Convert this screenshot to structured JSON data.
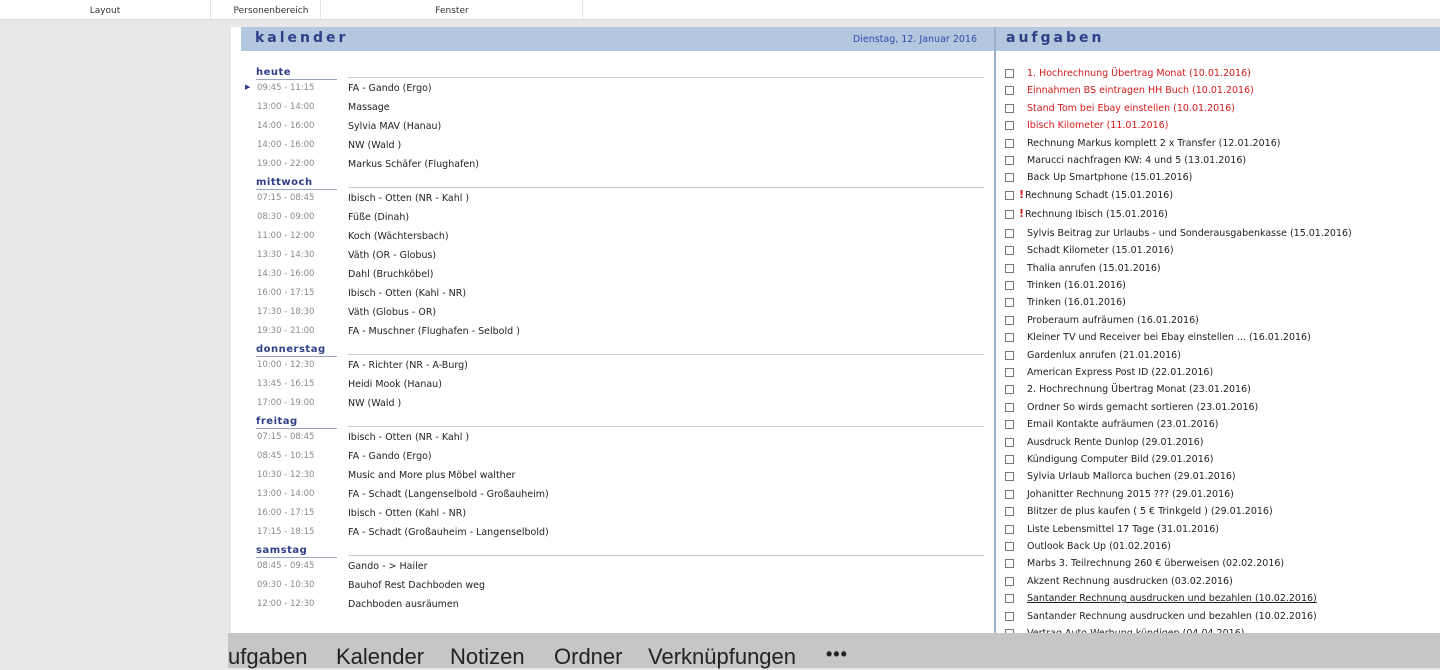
{
  "topbar": {
    "tabs": [
      "Layout",
      "Personenbereich",
      "Fenster"
    ]
  },
  "calendar": {
    "title": "kalender",
    "date": "Dienstag, 12. Januar 2016",
    "days": [
      {
        "name": "heute",
        "appointments": [
          {
            "time": "09:45 - 11:15",
            "title": "FA - Gando (Ergo)",
            "current": true
          },
          {
            "time": "13:00 - 14:00",
            "title": "Massage"
          },
          {
            "time": "14:00 - 16:00",
            "title": "Sylvia MAV (Hanau)"
          },
          {
            "time": "14:00 - 16:00",
            "title": "NW (Wald )"
          },
          {
            "time": "19:00 - 22:00",
            "title": "Markus Schäfer (Flughafen)"
          }
        ]
      },
      {
        "name": "mittwoch",
        "appointments": [
          {
            "time": "07:15 - 08:45",
            "title": "Ibisch - Otten (NR - Kahl )"
          },
          {
            "time": "08:30 - 09:00",
            "title": "Füße (Dinah)"
          },
          {
            "time": "11:00 - 12:00",
            "title": "Koch (Wächtersbach)"
          },
          {
            "time": "13:30 - 14:30",
            "title": "Väth (OR - Globus)"
          },
          {
            "time": "14:30 - 16:00",
            "title": "Dahl (Bruchköbel)"
          },
          {
            "time": "16:00 - 17:15",
            "title": "Ibisch - Otten (Kahl - NR)"
          },
          {
            "time": "17:30 - 18:30",
            "title": "Väth (Globus - OR)"
          },
          {
            "time": "19:30 - 21:00",
            "title": "FA - Muschner (Flughafen - Selbold )"
          }
        ]
      },
      {
        "name": "donnerstag",
        "appointments": [
          {
            "time": "10:00 - 12:30",
            "title": "FA - Richter (NR - A-Burg)"
          },
          {
            "time": "13:45 - 16:15",
            "title": "Heidi Mook (Hanau)"
          },
          {
            "time": "17:00 - 19:00",
            "title": "NW (Wald )"
          }
        ]
      },
      {
        "name": "freitag",
        "appointments": [
          {
            "time": "07:15 - 08:45",
            "title": "Ibisch - Otten (NR - Kahl )"
          },
          {
            "time": "08:45 - 10:15",
            "title": "FA - Gando (Ergo)"
          },
          {
            "time": "10:30 - 12:30",
            "title": "Music and More plus Möbel walther"
          },
          {
            "time": "13:00 - 14:00",
            "title": "FA - Schadt (Langenselbold - Großauheim)"
          },
          {
            "time": "16:00 - 17:15",
            "title": "Ibisch - Otten (Kahl - NR)"
          },
          {
            "time": "17:15 - 18:15",
            "title": "FA - Schadt (Großauheim - Langenselbold)"
          }
        ]
      },
      {
        "name": "samstag",
        "appointments": [
          {
            "time": "08:45 - 09:45",
            "title": "Gando - > Hailer"
          },
          {
            "time": "09:30 - 10:30",
            "title": "Bauhof Rest Dachboden weg"
          },
          {
            "time": "12:00 - 12:30",
            "title": "Dachboden ausräumen"
          }
        ]
      }
    ]
  },
  "tasks": {
    "title": "aufgaben",
    "items": [
      {
        "text": "1. Hochrechnung Übertrag Monat (10.01.2016)",
        "overdue": true
      },
      {
        "text": "Einnahmen BS eintragen HH Buch (10.01.2016)",
        "overdue": true
      },
      {
        "text": "Stand Tom bei Ebay einstellen (10.01.2016)",
        "overdue": true
      },
      {
        "text": "Ibisch Kilometer (11.01.2016)",
        "overdue": true
      },
      {
        "text": "Rechnung Markus komplett 2 x Transfer (12.01.2016)"
      },
      {
        "text": "Marucci nachfragen KW: 4 und 5 (13.01.2016)"
      },
      {
        "text": "Back Up Smartphone (15.01.2016)"
      },
      {
        "text": "Rechnung Schadt (15.01.2016)",
        "important": true
      },
      {
        "text": "Rechnung Ibisch (15.01.2016)",
        "important": true
      },
      {
        "text": "Sylvis Beitrag zur Urlaubs - und Sonderausgabenkasse (15.01.2016)"
      },
      {
        "text": "Schadt Kilometer (15.01.2016)"
      },
      {
        "text": "Thalia anrufen (15.01.2016)"
      },
      {
        "text": "Trinken (16.01.2016)"
      },
      {
        "text": "Trinken (16.01.2016)"
      },
      {
        "text": "Proberaum aufräumen (16.01.2016)"
      },
      {
        "text": "Kleiner TV und Receiver bei Ebay einstellen ... (16.01.2016)"
      },
      {
        "text": "Gardenlux anrufen (21.01.2016)"
      },
      {
        "text": "American Express Post ID (22.01.2016)"
      },
      {
        "text": "2. Hochrechnung Übertrag Monat (23.01.2016)"
      },
      {
        "text": "Ordner So wirds gemacht sortieren (23.01.2016)"
      },
      {
        "text": "Email Kontakte aufräumen (23.01.2016)"
      },
      {
        "text": "Ausdruck Rente Dunlop (29.01.2016)"
      },
      {
        "text": "Kündigung Computer Bild (29.01.2016)"
      },
      {
        "text": "Sylvia Urlaub Mallorca buchen (29.01.2016)"
      },
      {
        "text": "Johanitter Rechnung 2015 ??? (29.01.2016)"
      },
      {
        "text": "Blitzer de plus kaufen ( 5 € Trinkgeld ) (29.01.2016)"
      },
      {
        "text": "Liste Lebensmittel 17 Tage (31.01.2016)"
      },
      {
        "text": "Outlook Back Up (01.02.2016)"
      },
      {
        "text": "Marbs 3. Teilrechnung 260 € überweisen (02.02.2016)"
      },
      {
        "text": "Akzent Rechnung ausdrucken (03.02.2016)"
      },
      {
        "text": "Santander Rechnung ausdrucken und bezahlen (10.02.2016)",
        "underlined": true
      },
      {
        "text": "Santander Rechnung ausdrucken und bezahlen (10.02.2016)"
      },
      {
        "text": "Vertrag Auto Werbung kündigen (04.04.2016)"
      }
    ]
  },
  "bottomnav": {
    "items": [
      "ufgaben",
      "Kalender",
      "Notizen",
      "Ordner",
      "Verknüpfungen"
    ],
    "more": "•••"
  }
}
